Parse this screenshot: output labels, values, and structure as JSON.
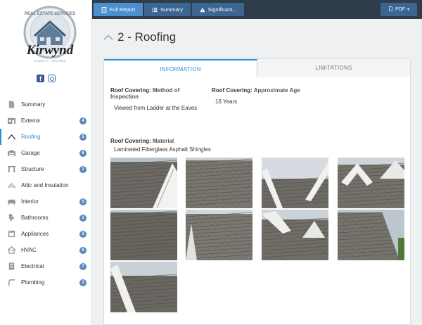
{
  "brand": {
    "logo_top": "REAL ESTATE SERVICES",
    "logo_name": "Kirwynd",
    "logo_bottom": "INTEGRITY · CERTIFIED"
  },
  "colors": {
    "accent": "#2d8fd6",
    "topbar": "#2f3d4b",
    "button": "#3c6592",
    "badge": "#5b87b8"
  },
  "toolbar": {
    "full_report": "Full Report",
    "summary": "Summary",
    "significant": "Significant...",
    "pdf": "PDF"
  },
  "sidebar": {
    "items": [
      {
        "label": "Summary",
        "icon": "document-icon",
        "count": ""
      },
      {
        "label": "Exterior",
        "icon": "house-icon",
        "count": "4"
      },
      {
        "label": "Roofing",
        "icon": "roof-icon",
        "count": "5"
      },
      {
        "label": "Garage",
        "icon": "garage-icon",
        "count": "6"
      },
      {
        "label": "Structure",
        "icon": "structure-icon",
        "count": "1"
      },
      {
        "label": "Attic and Insulation",
        "icon": "attic-icon",
        "count": ""
      },
      {
        "label": "Interior",
        "icon": "sofa-icon",
        "count": "5"
      },
      {
        "label": "Bathrooms",
        "icon": "toilet-icon",
        "count": "1"
      },
      {
        "label": "Appliances",
        "icon": "appliance-icon",
        "count": "2"
      },
      {
        "label": "HVAC",
        "icon": "hvac-icon",
        "count": "5"
      },
      {
        "label": "Electrical",
        "icon": "electrical-panel-icon",
        "count": "7"
      },
      {
        "label": "Plumbing",
        "icon": "pipe-icon",
        "count": "3"
      }
    ]
  },
  "section": {
    "title": "2 - Roofing"
  },
  "tabs": {
    "information": "INFORMATION",
    "limitations": "LIMITATIONS"
  },
  "fields": {
    "method": {
      "label_bold": "Roof Covering:",
      "label_rest": "Method of Inspection",
      "value": "Viewed from Ladder at the Eaves"
    },
    "age": {
      "label_bold": "Roof Covering:",
      "label_rest": "Approximate Age",
      "value": "16 Years"
    },
    "material": {
      "label_bold": "Roof Covering:",
      "label_rest": "Material",
      "value": "Laminated Fiberglass Asphalt Shingles"
    }
  },
  "photo_count": 9
}
